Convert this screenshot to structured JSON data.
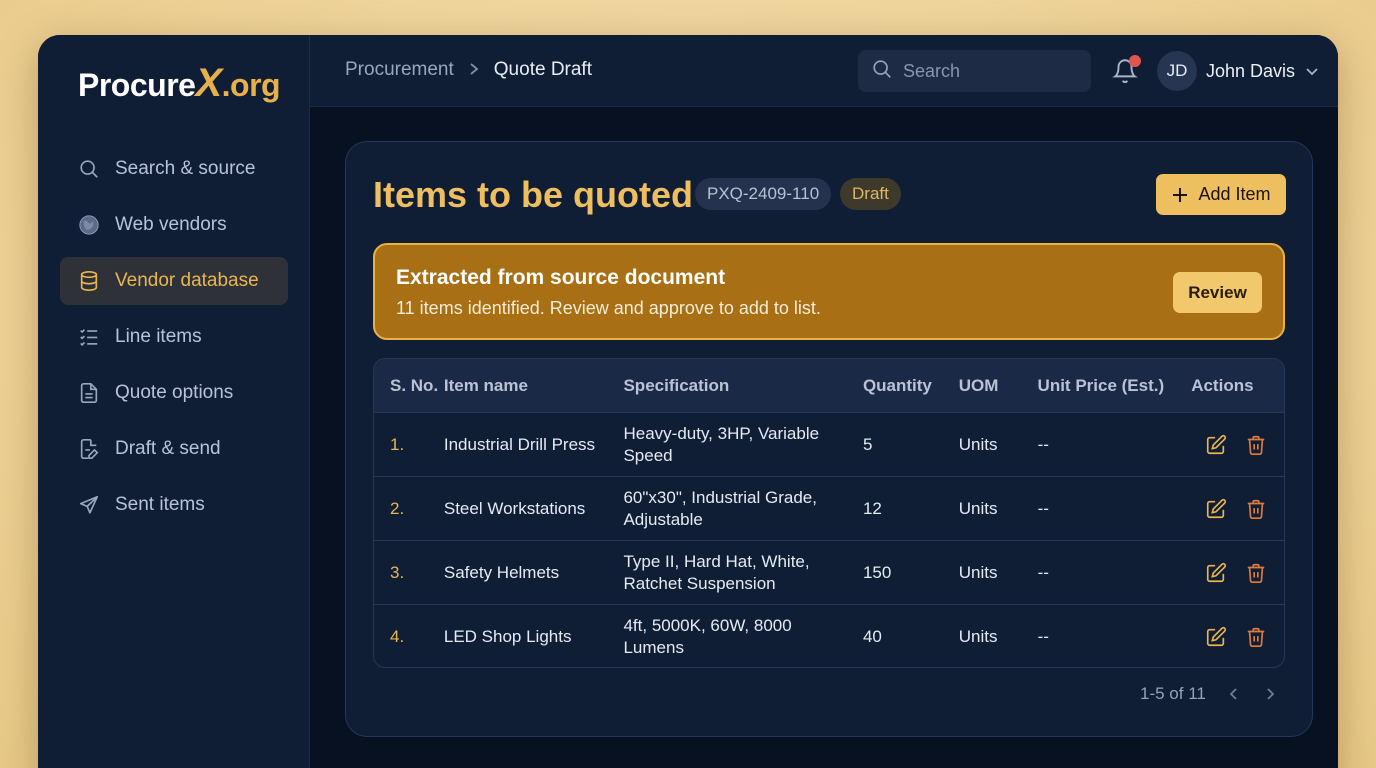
{
  "brand": {
    "name": "Procure",
    "x": "X",
    "suffix": ".org"
  },
  "sidebar": {
    "items": [
      {
        "label": "Search & source",
        "icon": "search-icon",
        "active": false
      },
      {
        "label": "Web vendors",
        "icon": "globe-icon",
        "active": false
      },
      {
        "label": "Vendor database",
        "icon": "database-icon",
        "active": true
      },
      {
        "label": "Line items",
        "icon": "list-check-icon",
        "active": false
      },
      {
        "label": "Quote options",
        "icon": "document-icon",
        "active": false
      },
      {
        "label": "Draft & send",
        "icon": "document-edit-icon",
        "active": false
      },
      {
        "label": "Sent items",
        "icon": "send-icon",
        "active": false
      }
    ]
  },
  "topbar": {
    "breadcrumb": [
      "Procurement",
      "Quote Draft"
    ],
    "search_placeholder": "Search",
    "user": {
      "initials": "JD",
      "name": "John Davis"
    },
    "notification_dot": true
  },
  "card": {
    "title": "Items to be quoted",
    "quote_id": "PXQ-2409-110",
    "status": "Draft",
    "add_button": "Add Item"
  },
  "banner": {
    "title": "Extracted from source document",
    "text": "11 items identified. Review and approve to add to list.",
    "button": "Review"
  },
  "table": {
    "columns": [
      "S. No.",
      "Item name",
      "Specification",
      "Quantity",
      "UOM",
      "Unit Price (Est.)",
      "Actions"
    ],
    "rows": [
      {
        "no": "1.",
        "name": "Industrial Drill Press",
        "spec": "Heavy-duty, 3HP, Variable Speed",
        "qty": "5",
        "uom": "Units",
        "price": "--"
      },
      {
        "no": "2.",
        "name": "Steel Workstations",
        "spec": "60\"x30\", Industrial Grade, Adjustable",
        "qty": "12",
        "uom": "Units",
        "price": "--"
      },
      {
        "no": "3.",
        "name": "Safety Helmets",
        "spec": "Type II, Hard Hat, White, Ratchet Suspension",
        "qty": "150",
        "uom": "Units",
        "price": "--"
      },
      {
        "no": "4.",
        "name": "LED Shop Lights",
        "spec": "4ft, 5000K, 60W, 8000 Lumens",
        "qty": "40",
        "uom": "Units",
        "price": "--"
      }
    ]
  },
  "pagination": {
    "text": "1-5 of 11"
  },
  "colors": {
    "accent": "#efbf5f",
    "banner": "#a86f15",
    "delete": "#e07b3a",
    "notification": "#e0554d"
  }
}
